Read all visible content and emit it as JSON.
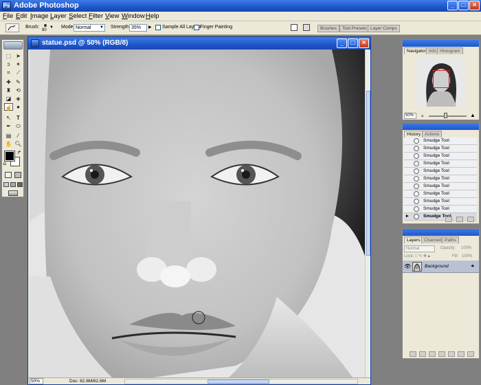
{
  "app": {
    "title": "Adobe Photoshop"
  },
  "window_controls": {
    "minimize": "_",
    "maximize": "□",
    "close": "×"
  },
  "menu": [
    "File",
    "Edit",
    "Image",
    "Layer",
    "Select",
    "Filter",
    "View",
    "Window",
    "Help"
  ],
  "options_bar": {
    "brush_label": "Brush:",
    "brush_size": "80",
    "mode_label": "Mode:",
    "mode_value": "Normal",
    "strength_label": "Strength:",
    "strength_value": "35%",
    "sample_all_layers": "Sample All Layers",
    "finger_painting": "Finger Painting"
  },
  "palette_well": [
    "Brushes",
    "Tool Presets",
    "Layer Comps"
  ],
  "document": {
    "title": "statue.psd @ 50% (RGB/8)",
    "zoom": "50%",
    "doc_size": "Doc: 62.6M/62.6M"
  },
  "navigator": {
    "tabs": [
      "Navigator",
      "Info",
      "Histogram"
    ],
    "zoom": "50%"
  },
  "history": {
    "tabs": [
      "History",
      "Actions"
    ],
    "items": [
      "Smudge Tool",
      "Smudge Tool",
      "Smudge Tool",
      "Smudge Tool",
      "Smudge Tool",
      "Smudge Tool",
      "Smudge Tool",
      "Smudge Tool",
      "Smudge Tool",
      "Smudge Tool",
      "Smudge Tool"
    ]
  },
  "layers": {
    "tabs": [
      "Layers",
      "Channels",
      "Paths"
    ],
    "blend_mode": "Normal",
    "opacity_label": "Opacity:",
    "opacity_value": "100%",
    "lock_label": "Lock:",
    "fill_label": "Fill:",
    "fill_value": "100%",
    "layer_name": "Background"
  },
  "colors": {
    "titlebar": "#1e56c9",
    "close_button": "#c3391b",
    "chrome": "#ece9d8",
    "workspace": "#808080"
  }
}
